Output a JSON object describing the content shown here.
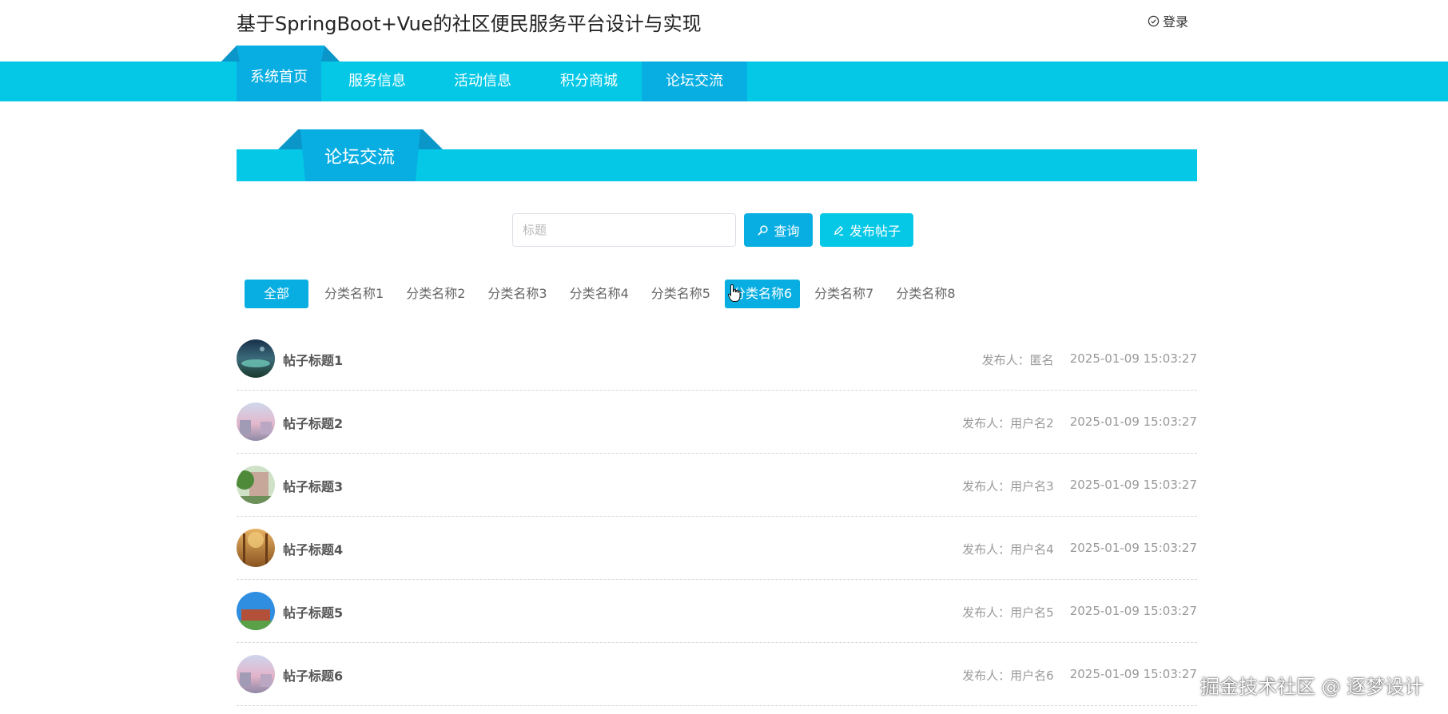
{
  "header": {
    "site_title": "基于SpringBoot+Vue的社区便民服务平台设计与实现",
    "login_label": "登录"
  },
  "nav": {
    "items": [
      {
        "label": "系统首页"
      },
      {
        "label": "服务信息"
      },
      {
        "label": "活动信息"
      },
      {
        "label": "积分商城"
      },
      {
        "label": "论坛交流"
      }
    ],
    "active_index": 4
  },
  "section": {
    "title": "论坛交流"
  },
  "search": {
    "placeholder": "标题",
    "value": "",
    "search_label": "查询",
    "post_label": "发布帖子"
  },
  "categories": {
    "items": [
      {
        "label": "全部"
      },
      {
        "label": "分类名称1"
      },
      {
        "label": "分类名称2"
      },
      {
        "label": "分类名称3"
      },
      {
        "label": "分类名称4"
      },
      {
        "label": "分类名称5"
      },
      {
        "label": "分类名称6"
      },
      {
        "label": "分类名称7"
      },
      {
        "label": "分类名称8"
      }
    ],
    "active": [
      "全部",
      "分类名称6"
    ]
  },
  "posts": [
    {
      "title": "帖子标题1",
      "author_label": "发布人：匿名",
      "time": "2025-01-09 15:03:27"
    },
    {
      "title": "帖子标题2",
      "author_label": "发布人：用户名2",
      "time": "2025-01-09 15:03:27"
    },
    {
      "title": "帖子标题3",
      "author_label": "发布人：用户名3",
      "time": "2025-01-09 15:03:27"
    },
    {
      "title": "帖子标题4",
      "author_label": "发布人：用户名4",
      "time": "2025-01-09 15:03:27"
    },
    {
      "title": "帖子标题5",
      "author_label": "发布人：用户名5",
      "time": "2025-01-09 15:03:27"
    },
    {
      "title": "帖子标题6",
      "author_label": "发布人：用户名6",
      "time": "2025-01-09 15:03:27"
    }
  ],
  "watermark": "掘金技术社区 @ 逐梦设计",
  "colors": {
    "nav_bg": "#05c8e6",
    "nav_active": "#08aee2",
    "accent": "#08aee2"
  }
}
